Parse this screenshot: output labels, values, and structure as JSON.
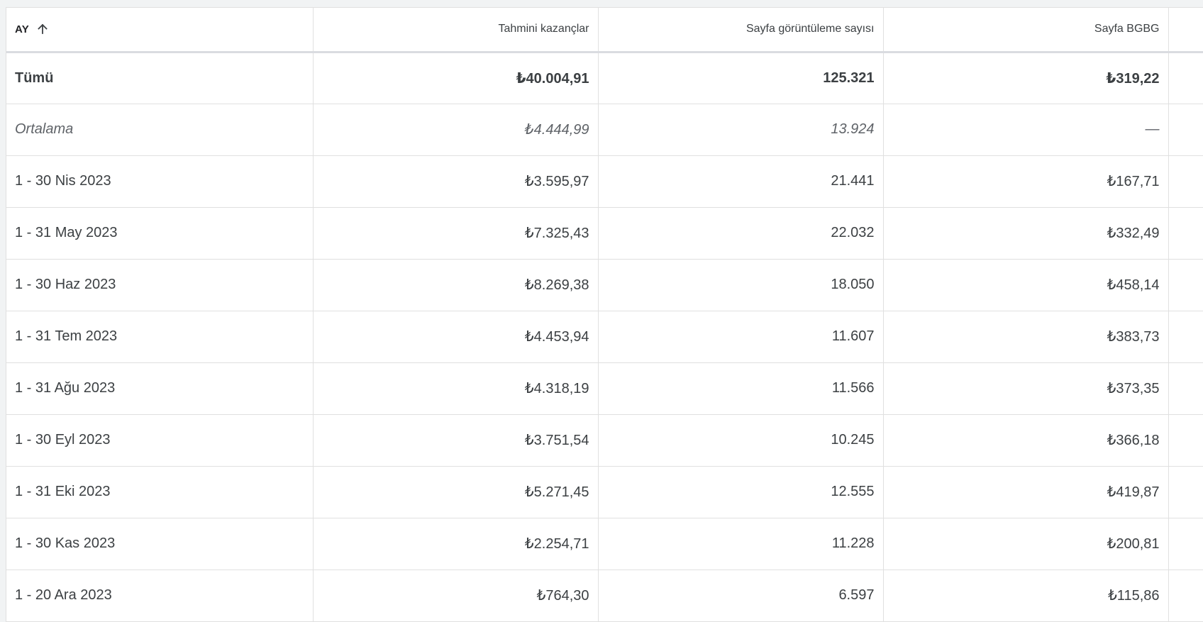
{
  "table": {
    "headers": {
      "month": "AY",
      "earnings": "Tahmini kazançlar",
      "page_views": "Sayfa görüntüleme sayısı",
      "page_rpm": "Sayfa BGBG"
    },
    "sort": {
      "column": "month",
      "direction": "ascending",
      "icon": "arrow-up-icon"
    },
    "total": {
      "label": "Tümü",
      "earnings": "₺40.004,91",
      "page_views": "125.321",
      "page_rpm": "₺319,22"
    },
    "average": {
      "label": "Ortalama",
      "earnings": "₺4.444,99",
      "page_views": "13.924",
      "page_rpm": "—"
    },
    "rows": [
      {
        "month": "1 - 30 Nis 2023",
        "earnings": "₺3.595,97",
        "page_views": "21.441",
        "page_rpm": "₺167,71"
      },
      {
        "month": "1 - 31 May 2023",
        "earnings": "₺7.325,43",
        "page_views": "22.032",
        "page_rpm": "₺332,49"
      },
      {
        "month": "1 - 30 Haz 2023",
        "earnings": "₺8.269,38",
        "page_views": "18.050",
        "page_rpm": "₺458,14"
      },
      {
        "month": "1 - 31 Tem 2023",
        "earnings": "₺4.453,94",
        "page_views": "11.607",
        "page_rpm": "₺383,73"
      },
      {
        "month": "1 - 31 Ağu 2023",
        "earnings": "₺4.318,19",
        "page_views": "11.566",
        "page_rpm": "₺373,35"
      },
      {
        "month": "1 - 30 Eyl 2023",
        "earnings": "₺3.751,54",
        "page_views": "10.245",
        "page_rpm": "₺366,18"
      },
      {
        "month": "1 - 31 Eki 2023",
        "earnings": "₺5.271,45",
        "page_views": "12.555",
        "page_rpm": "₺419,87"
      },
      {
        "month": "1 - 30 Kas 2023",
        "earnings": "₺2.254,71",
        "page_views": "11.228",
        "page_rpm": "₺200,81"
      },
      {
        "month": "1 - 20 Ara 2023",
        "earnings": "₺764,30",
        "page_views": "6.597",
        "page_rpm": "₺115,86"
      }
    ]
  },
  "colors": {
    "page_background": "#f1f3f4",
    "table_background": "#ffffff",
    "grid_line": "#e0e0e0",
    "text": "#3c4043"
  }
}
